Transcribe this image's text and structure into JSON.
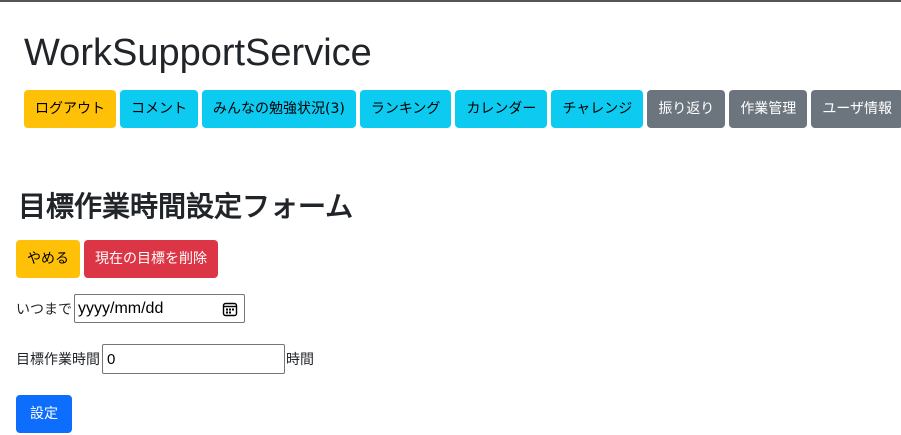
{
  "app": {
    "title": "WorkSupportService"
  },
  "nav": {
    "logout": "ログアウト",
    "comment": "コメント",
    "everyone_study": "みんなの勉強状況(3)",
    "ranking": "ランキング",
    "calendar": "カレンダー",
    "challenge": "チャレンジ",
    "review": "振り返り",
    "task_management": "作業管理",
    "user_info": "ユーザ情報"
  },
  "form": {
    "title": "目標作業時間設定フォーム",
    "cancel_label": "やめる",
    "delete_label": "現在の目標を削除",
    "deadline_label": "いつまで",
    "deadline_placeholder": "yyyy/mm/dd",
    "hours_label": "目標作業時間",
    "hours_value": "0",
    "hours_unit": "時間",
    "submit_label": "設定"
  },
  "colors": {
    "warning": "#ffc107",
    "info": "#0dcaf0",
    "secondary": "#6c757d",
    "danger": "#dc3545",
    "primary": "#0d6efd"
  },
  "icons": {
    "date_picker": "calendar-icon"
  }
}
